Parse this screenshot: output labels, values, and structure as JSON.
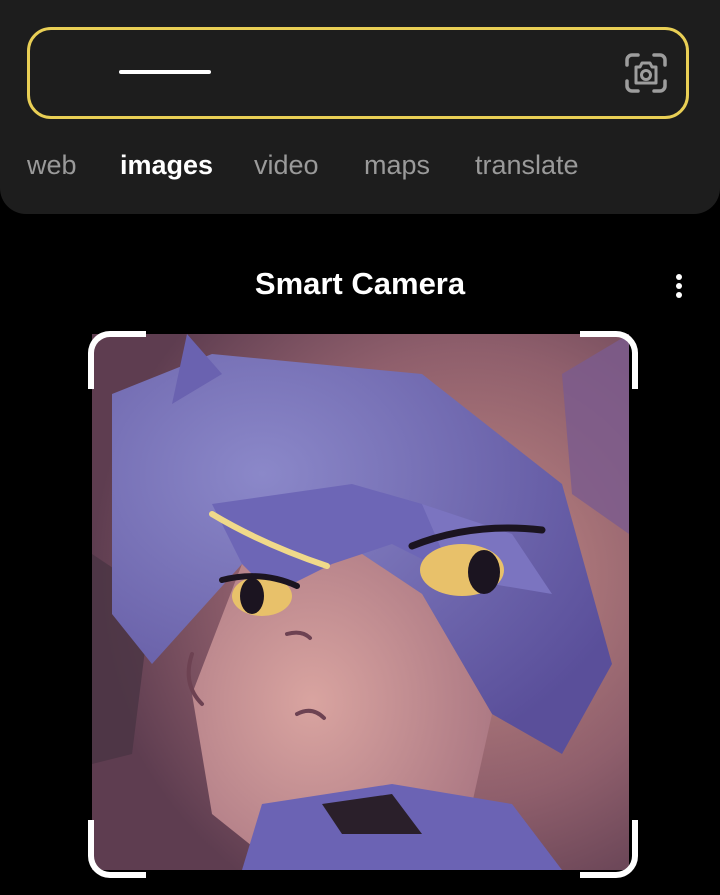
{
  "search": {
    "value": "",
    "placeholder": "",
    "camera_icon": "camera-icon",
    "border_color": "#e9cf55"
  },
  "tabs": [
    {
      "label": "web",
      "active": false
    },
    {
      "label": "images",
      "active": true
    },
    {
      "label": "video",
      "active": false
    },
    {
      "label": "maps",
      "active": false
    },
    {
      "label": "translate",
      "active": false
    }
  ],
  "main": {
    "title": "Smart Camera",
    "more_icon": "more-vertical-icon"
  },
  "preview": {
    "content": "captured image",
    "frame_color": "#ffffff"
  },
  "colors": {
    "background": "#000000",
    "topbar": "#1d1d1d",
    "tab_inactive": "#9a9a9a",
    "tab_active": "#ffffff"
  }
}
